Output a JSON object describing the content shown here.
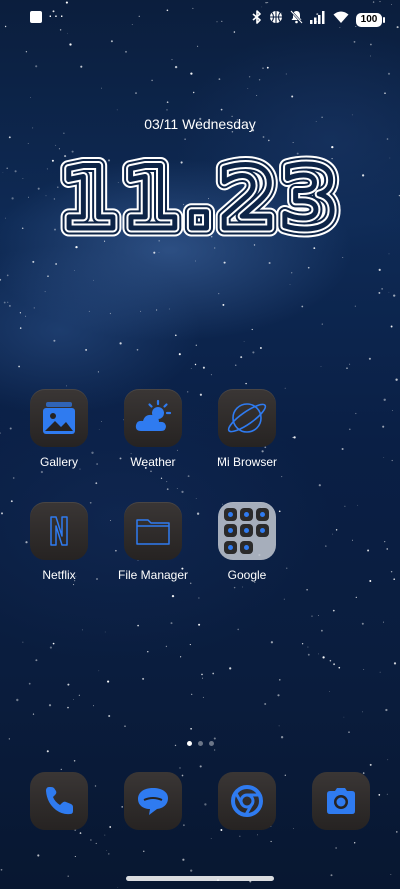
{
  "status_bar": {
    "notification_dots": "···",
    "battery_level": "100",
    "icons": [
      "square-notification-icon",
      "bluetooth-icon",
      "basketball-icon",
      "silent-bell-icon",
      "cellular-signal-icon",
      "wifi-icon",
      "battery-icon"
    ]
  },
  "lockscreen_widget": {
    "date": "03/11 Wednesday",
    "time": "11.23"
  },
  "apps": [
    {
      "label": "Gallery",
      "icon": "gallery-icon"
    },
    {
      "label": "Weather",
      "icon": "weather-icon"
    },
    {
      "label": "Mi Browser",
      "icon": "browser-planet-icon"
    },
    {
      "label": "Netflix",
      "icon": "netflix-icon"
    },
    {
      "label": "File Manager",
      "icon": "folder-icon"
    },
    {
      "label": "Google",
      "icon": "google-folder-icon"
    }
  ],
  "page_indicator": {
    "count": 3,
    "active": 1
  },
  "dock": [
    {
      "name": "phone",
      "icon": "phone-icon"
    },
    {
      "name": "messages",
      "icon": "message-icon"
    },
    {
      "name": "chrome",
      "icon": "chrome-icon"
    },
    {
      "name": "camera",
      "icon": "camera-icon"
    }
  ],
  "colors": {
    "accent_blue": "#2f7bf0",
    "tile_dark": "#2e2a29",
    "sky_top": "#0b1e3d",
    "sky_mid": "#0e2a55"
  }
}
